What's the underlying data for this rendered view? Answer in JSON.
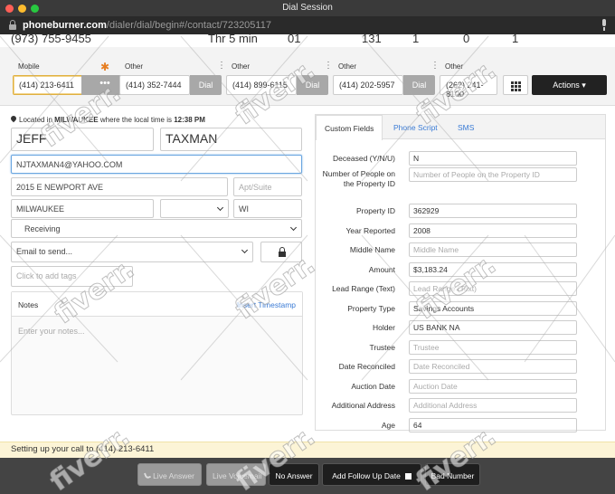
{
  "window": {
    "title": "Dial Session"
  },
  "browser": {
    "url_domain": "phoneburner.com",
    "url_path": "/dialer/dial/begin#/contact/723205117"
  },
  "stats_row": [
    "(973) 755-9455",
    "Thr 5 min",
    "01",
    "131",
    "1",
    "0",
    "1"
  ],
  "phones": [
    {
      "label": "Mobile",
      "number": "(414) 213-6411",
      "action": "•••"
    },
    {
      "label": "Other",
      "number": "(414) 352-7444",
      "action": "Dial"
    },
    {
      "label": "Other",
      "number": "(414) 899-6115",
      "action": "Dial"
    },
    {
      "label": "Other",
      "number": "(414) 202-5957",
      "action": "Dial"
    },
    {
      "label": "Other",
      "number": "(262) 241-8100"
    }
  ],
  "actions_label": "Actions ▾",
  "location": {
    "prefix": "Located in",
    "city": "MILWAUKEE",
    "middle": "where the local time is",
    "time": "12:38 PM"
  },
  "contact": {
    "first_name": "JEFF",
    "last_name": "TAXMAN",
    "email": "NJTAXMAN4@YAHOO.COM",
    "address": "2015 E NEWPORT AVE",
    "apt_placeholder": "Apt/Suite",
    "city": "MILWAUKEE",
    "state": "WI",
    "stage": "Receiving",
    "email_select": "Email to send...",
    "tags_placeholder": "Click to add tags"
  },
  "notes": {
    "title": "Notes",
    "insert_link": "Insert Timestamp",
    "placeholder": "Enter your notes..."
  },
  "tabs": [
    "Custom Fields",
    "Phone Script",
    "SMS"
  ],
  "custom_fields": [
    {
      "label": "Deceased (Y/N/U)",
      "value": "N"
    },
    {
      "label": "Number of People on the Property ID",
      "value": "",
      "placeholder": "Number of People on the Property ID"
    },
    {
      "label": "Property ID",
      "value": "362929"
    },
    {
      "label": "Year Reported",
      "value": "2008"
    },
    {
      "label": "Middle Name",
      "value": "",
      "placeholder": "Middle Name"
    },
    {
      "label": "Amount",
      "value": "$3,183.24"
    },
    {
      "label": "Lead Range (Text)",
      "value": "",
      "placeholder": "Lead Range (Text)"
    },
    {
      "label": "Property Type",
      "value": "Savings Accounts"
    },
    {
      "label": "Holder",
      "value": "US BANK NA"
    },
    {
      "label": "Trustee",
      "value": "",
      "placeholder": "Trustee"
    },
    {
      "label": "Date Reconciled",
      "value": "",
      "placeholder": "Date Reconciled"
    },
    {
      "label": "Auction Date",
      "value": "",
      "placeholder": "Auction Date"
    },
    {
      "label": "Additional Address",
      "value": "",
      "placeholder": "Additional Address"
    },
    {
      "label": "Age",
      "value": "64"
    }
  ],
  "status": "Setting up your call to (414) 213-6411",
  "bottom_buttons": {
    "live_answer": "Live Answer",
    "live_voicemail": "Live Voicemail",
    "no_answer": "No Answer",
    "follow_up": "Add Follow Up Date",
    "bad_number": "Bad Number"
  },
  "watermark": "fiverr."
}
